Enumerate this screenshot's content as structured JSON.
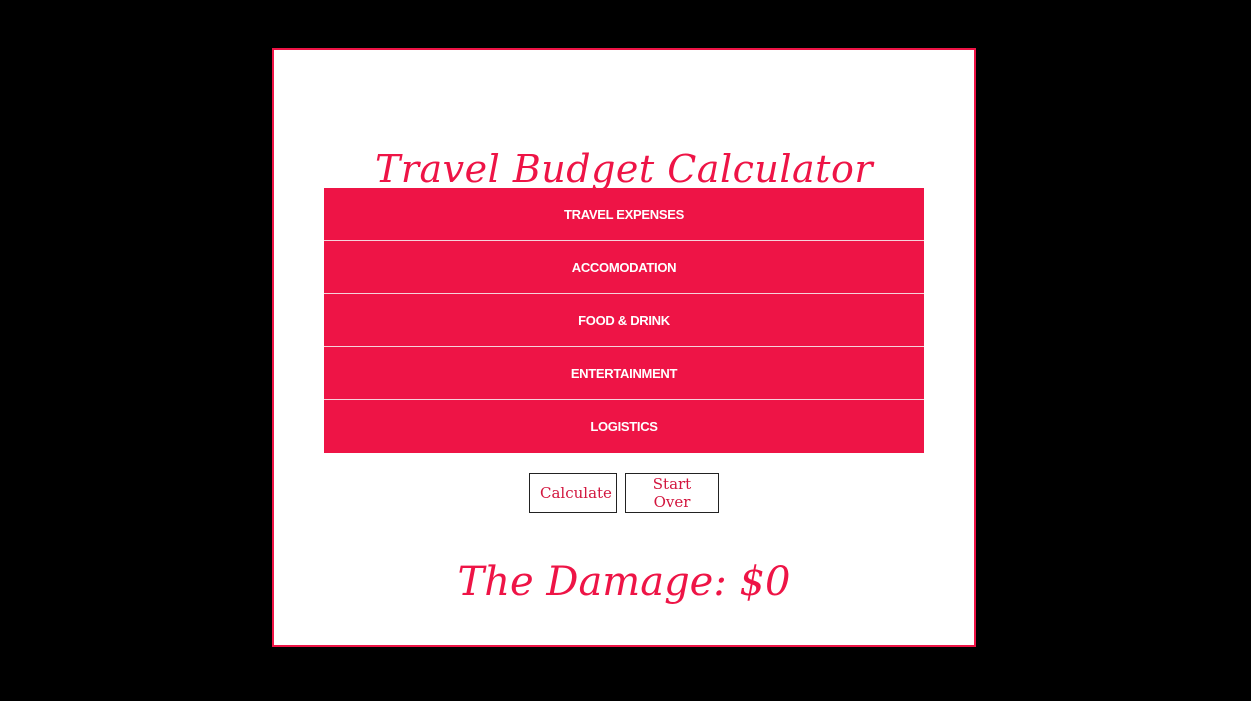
{
  "title": "Travel Budget Calculator",
  "sections": [
    {
      "label": "TRAVEL EXPENSES"
    },
    {
      "label": "ACCOMODATION"
    },
    {
      "label": "FOOD & DRINK"
    },
    {
      "label": "ENTERTAINMENT"
    },
    {
      "label": "LOGISTICS"
    }
  ],
  "buttons": {
    "calculate": "Calculate",
    "start_over": "Start Over"
  },
  "result": {
    "text": "The Damage: $0"
  },
  "colors": {
    "accent": "#ee1446",
    "background": "#000000",
    "card": "#ffffff"
  }
}
